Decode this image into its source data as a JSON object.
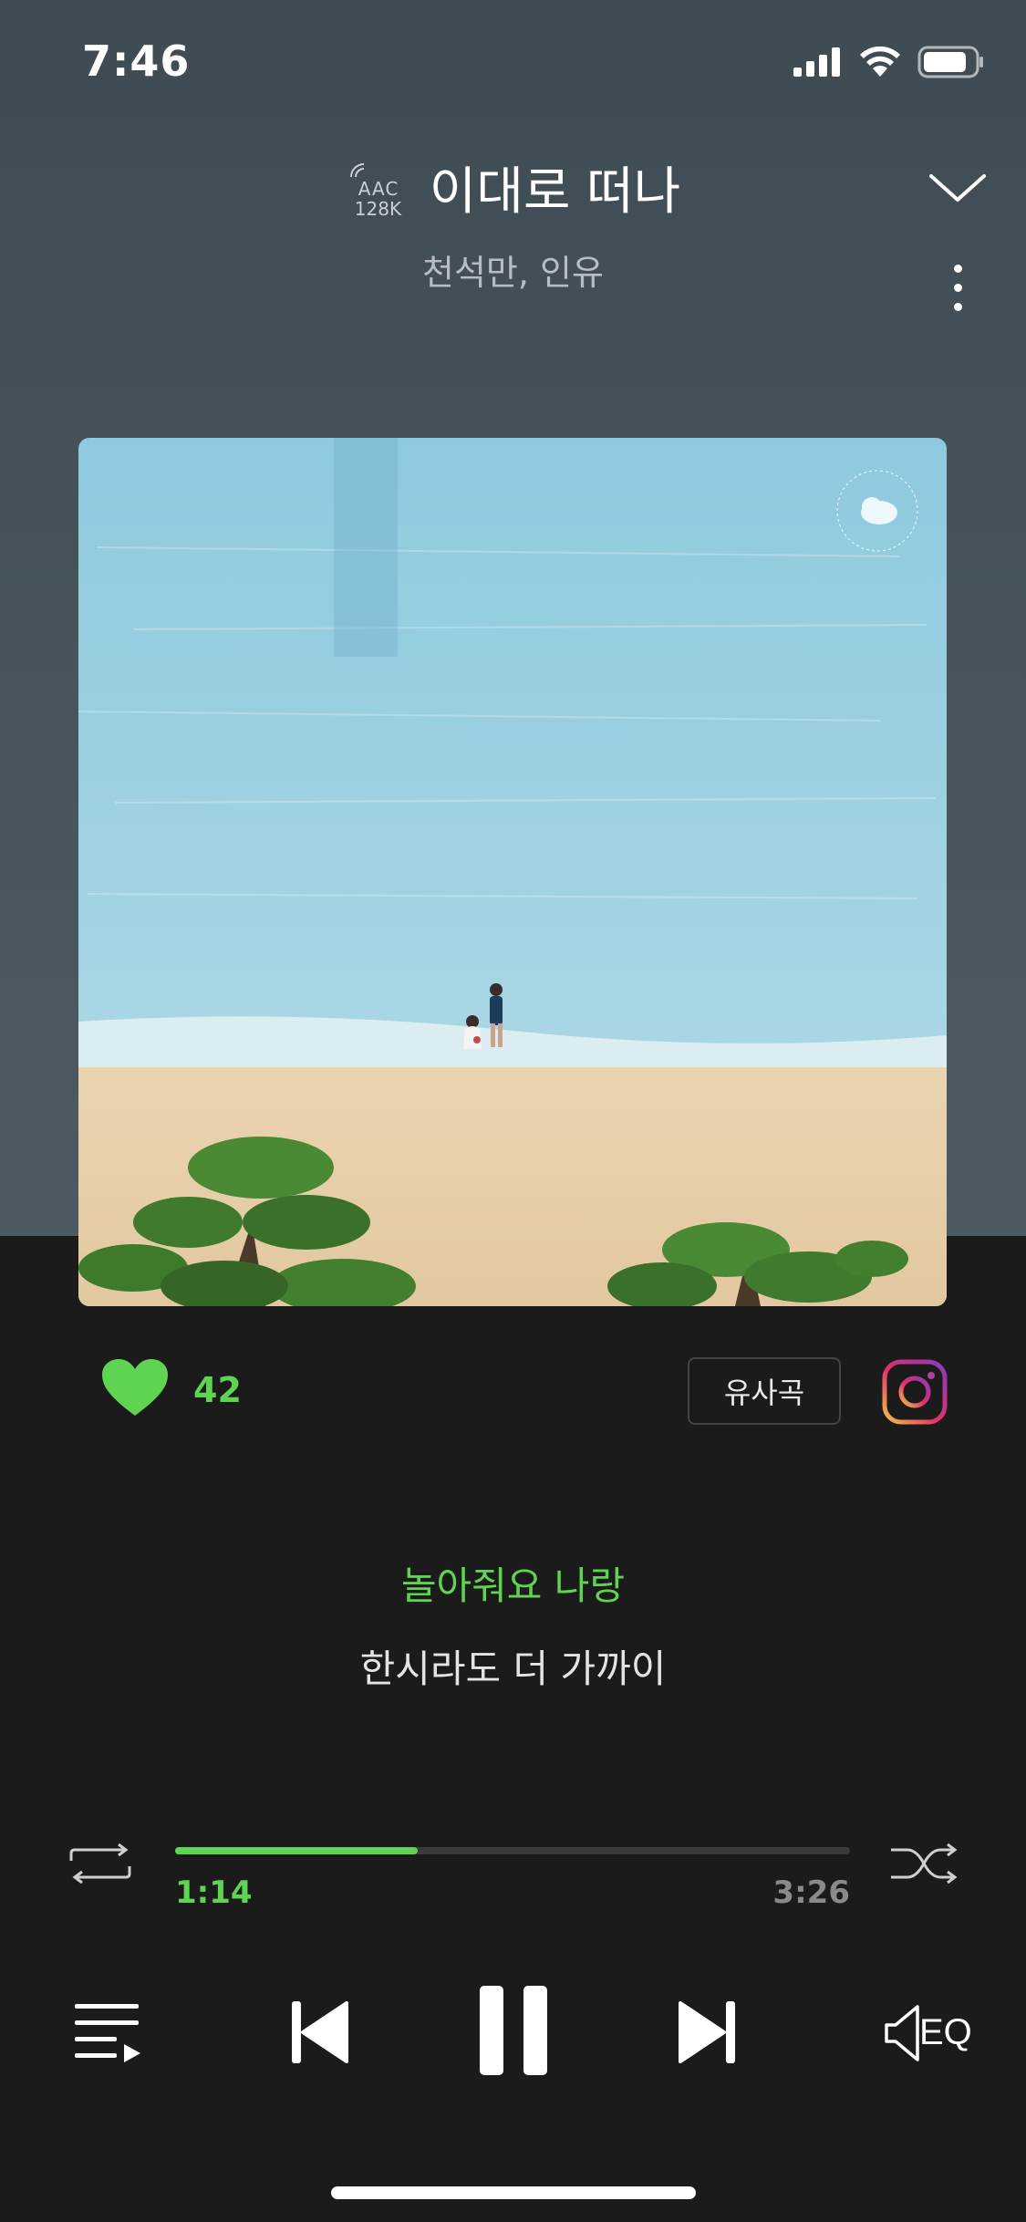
{
  "status_bar": {
    "time": "7:46",
    "icons": [
      "cellular-signal-icon",
      "wifi-icon",
      "battery-icon"
    ]
  },
  "header": {
    "codec_line1": "AAC",
    "codec_line2": "128K",
    "title": "이대로 떠나",
    "artist": "천석만, 인유"
  },
  "actions": {
    "like_count": "42",
    "similar_label": "유사곡"
  },
  "lyrics": {
    "current": "놀아줘요 나랑",
    "next": "한시라도 더 가까이"
  },
  "player": {
    "elapsed": "1:14",
    "duration": "3:26",
    "progress_fraction": 0.359
  },
  "controls": {
    "eq_label": "EQ"
  },
  "colors": {
    "accent": "#5fd352",
    "background": "#1b1b1b",
    "header_bg": "#47545c"
  }
}
